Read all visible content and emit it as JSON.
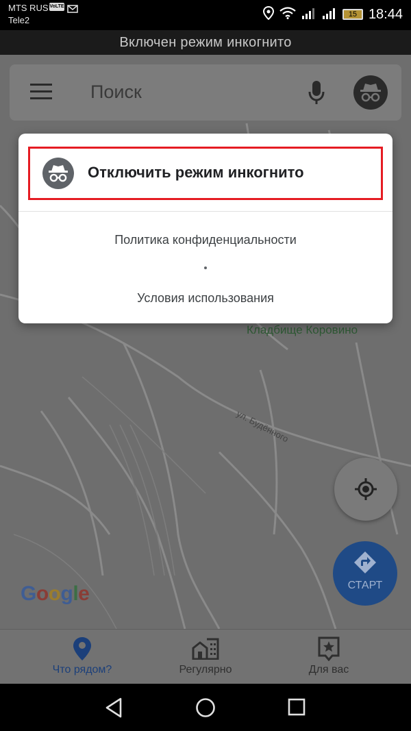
{
  "status_bar": {
    "carrier1": "MTS RUS",
    "volte": "VoLTE",
    "carrier2": "Tele2",
    "battery": "15",
    "time": "18:44"
  },
  "banner": "Включен режим инкогнито",
  "search": {
    "placeholder": "Поиск",
    "menu_icon": "hamburger-menu-icon",
    "mic_icon": "microphone-icon",
    "avatar_icon": "incognito-icon"
  },
  "map": {
    "cemetery": "Кладбище Коровино",
    "street": "ул. Будённого",
    "logo": [
      "G",
      "o",
      "o",
      "g",
      "l",
      "e"
    ],
    "colors": {
      "background": "#6e6e6e",
      "road": "#8c8c8c"
    }
  },
  "dialog": {
    "disable_label": "Отключить режим инкогнито",
    "privacy": "Политика конфиденциальности",
    "terms": "Условия использования",
    "highlight_color": "#e51c23"
  },
  "fab": {
    "start_label": "СТАРТ",
    "locate_icon": "my-location-icon"
  },
  "bottom_nav": {
    "items": [
      {
        "label": "Что рядом?",
        "icon": "location-pin-icon",
        "active": true
      },
      {
        "label": "Регулярно",
        "icon": "commute-buildings-icon",
        "active": false
      },
      {
        "label": "Для вас",
        "icon": "for-you-star-icon",
        "active": false
      }
    ]
  }
}
